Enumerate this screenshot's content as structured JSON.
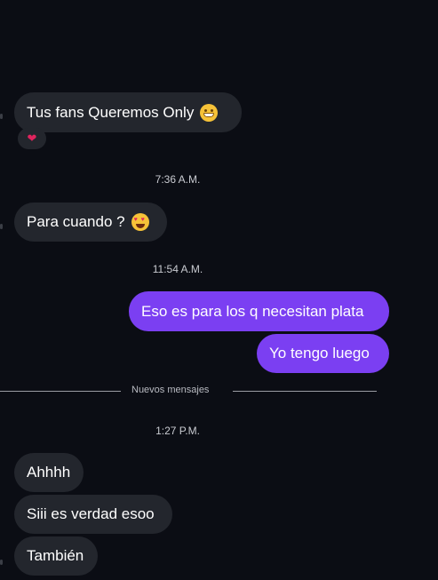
{
  "messages": [
    {
      "text": "Tus fans Queremos Only",
      "emoji": "grinning-face-icon"
    },
    {
      "text": "Para cuando ?",
      "emoji": "heart-eyes-icon"
    },
    {
      "text": "Eso es para los q necesitan plata"
    },
    {
      "text": "Yo tengo luego"
    },
    {
      "text": "Ahhhh"
    },
    {
      "text": "Siii es verdad esoo"
    },
    {
      "text": "También"
    }
  ],
  "reaction": {
    "glyph": "❤",
    "icon": "red-heart-icon"
  },
  "timestamps": [
    "7:36 A.M.",
    "11:54 A.M.",
    "1:27 P.M."
  ],
  "divider": {
    "label": "Nuevos mensajes"
  },
  "colors": {
    "background": "#0b0d14",
    "incoming_bubble": "#23262d",
    "outgoing_bubble": "#7b3ff2"
  }
}
